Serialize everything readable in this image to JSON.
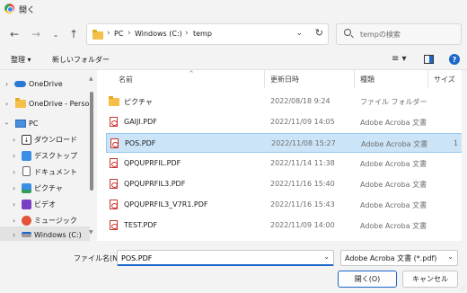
{
  "window": {
    "title": "開く"
  },
  "nav": {
    "back_icon": "arrow-left-icon",
    "forward_icon": "arrow-right-icon",
    "recent_icon": "chevron-down-icon",
    "up_icon": "arrow-up-icon"
  },
  "address": {
    "crumbs": [
      "PC",
      "Windows (C:)",
      "temp"
    ],
    "separator": "›"
  },
  "search": {
    "placeholder": "tempの検索"
  },
  "toolbar": {
    "organize_label": "整理 ▾",
    "new_folder_label": "新しいフォルダー",
    "view_icon": "≡ ▾"
  },
  "sidebar": {
    "items": [
      {
        "label": "OneDrive",
        "icon": "cloud-icon"
      },
      {
        "label": "OneDrive - Persor",
        "icon": "cloud-icon"
      },
      {
        "label": "PC",
        "icon": "pc-icon"
      },
      {
        "label": "ダウンロード",
        "icon": "download-icon"
      },
      {
        "label": "デスクトップ",
        "icon": "desktop-icon"
      },
      {
        "label": "ドキュメント",
        "icon": "document-icon"
      },
      {
        "label": "ピクチャ",
        "icon": "pictures-icon"
      },
      {
        "label": "ビデオ",
        "icon": "video-icon"
      },
      {
        "label": "ミュージック",
        "icon": "music-icon"
      },
      {
        "label": "Windows (C:)",
        "icon": "drive-icon"
      }
    ]
  },
  "columns": {
    "name": "名前",
    "modified": "更新日時",
    "type": "種類",
    "size": "サイズ"
  },
  "files": [
    {
      "name": "ピクチャ",
      "modified": "2022/08/18 9:24",
      "type": "ファイル フォルダー",
      "size": ""
    },
    {
      "name": "GAIJI.PDF",
      "modified": "2022/11/09 14:05",
      "type": "Adobe Acroba 文書",
      "size": ""
    },
    {
      "name": "POS.PDF",
      "modified": "2022/11/08 15:27",
      "type": "Adobe Acroba 文書",
      "size": "1"
    },
    {
      "name": "QPQUPRFIL.PDF",
      "modified": "2022/11/14 11:38",
      "type": "Adobe Acroba 文書",
      "size": ""
    },
    {
      "name": "QPQUPRFIL3.PDF",
      "modified": "2022/11/16 15:40",
      "type": "Adobe Acroba 文書",
      "size": ""
    },
    {
      "name": "QPQUPRFIL3_V7R1.PDF",
      "modified": "2022/11/16 15:43",
      "type": "Adobe Acroba 文書",
      "size": ""
    },
    {
      "name": "TEST.PDF",
      "modified": "2022/11/09 14:00",
      "type": "Adobe Acroba 文書",
      "size": ""
    }
  ],
  "footer": {
    "filename_label": "ファイル名(N):",
    "filename_value": "POS.PDF",
    "filter_value": "Adobe Acroba 文書 (*.pdf)",
    "open_label": "開く(O)",
    "cancel_label": "キャンセル"
  },
  "colors": {
    "accent": "#1a66c9",
    "selection": "#cce4f7",
    "folder": "#f5c04a",
    "pdf": "#c0392b"
  }
}
